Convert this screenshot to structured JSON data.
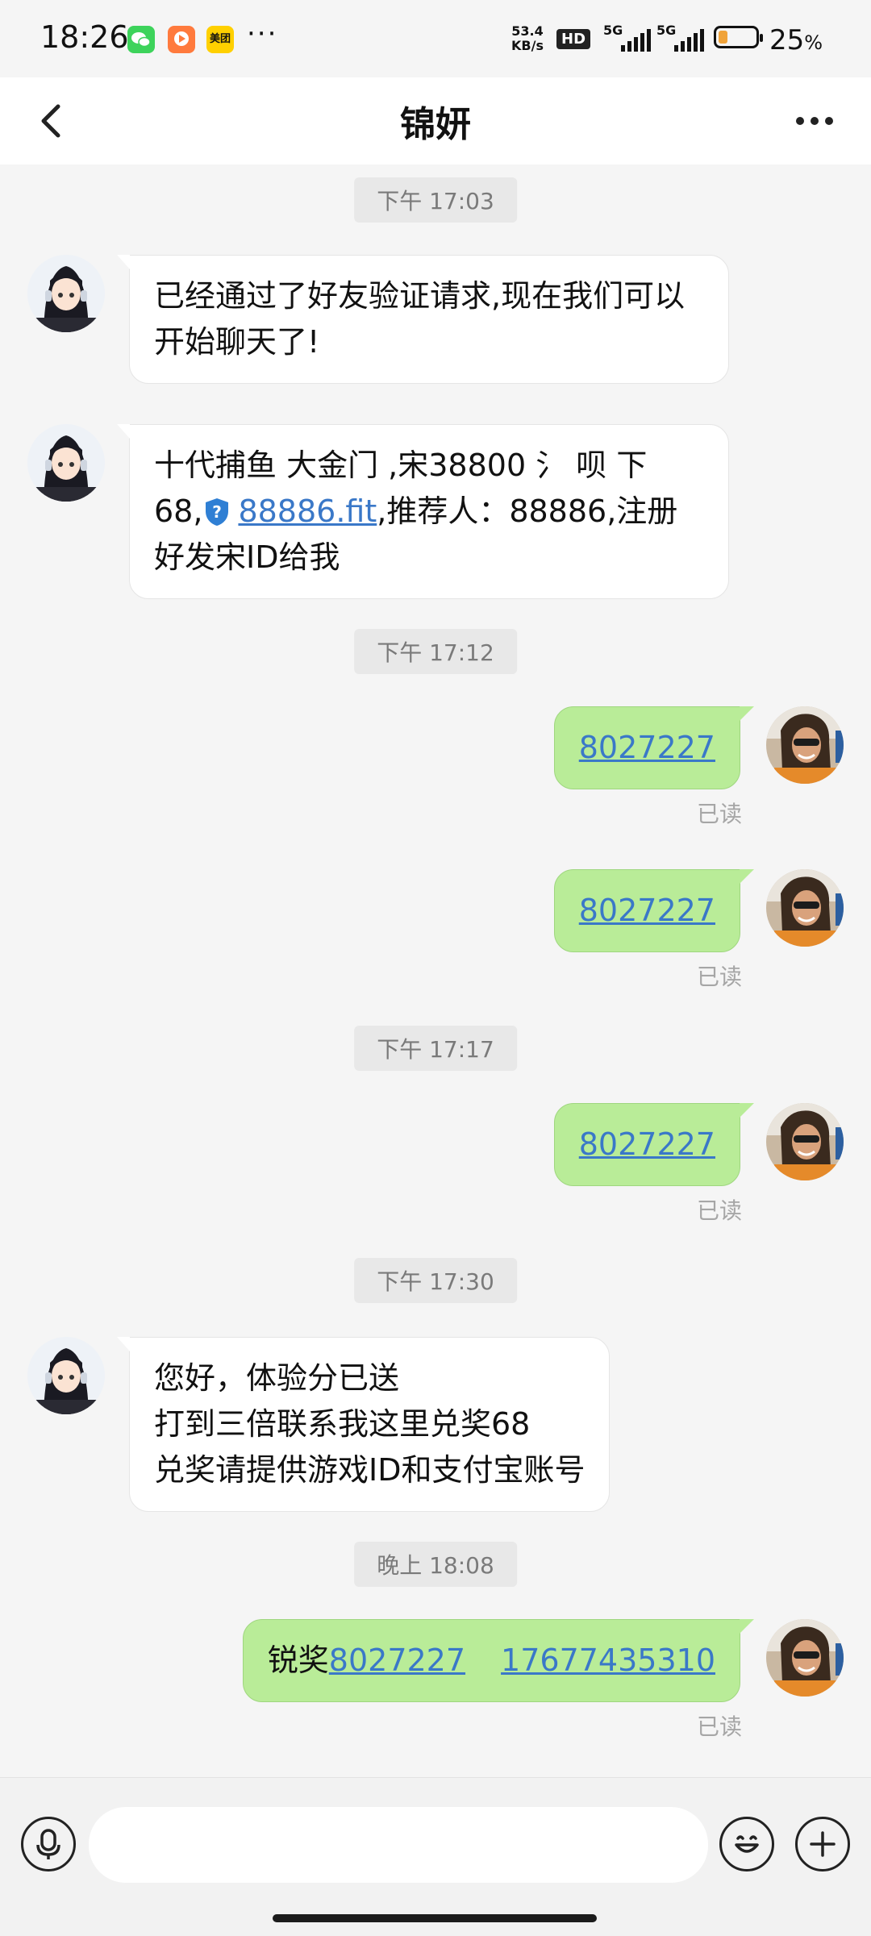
{
  "status_bar": {
    "time": "18:26",
    "net_speed_value": "53.4",
    "net_speed_unit": "KB/s",
    "hd_label": "HD",
    "signal1_label": "5G",
    "signal2_label": "5G",
    "battery_percent": "25",
    "battery_unit": "%",
    "battery_level": 0.25,
    "meituan_label": "美团",
    "more_dots": "···"
  },
  "header": {
    "title": "锦妍"
  },
  "messages": {
    "ts1": "下午 17:03",
    "m1_text": "已经通过了好友验证请求,现在我们可以开始聊天了!",
    "m2_line1": "十代捕鱼  大金门  ,宋38800 氵 呗 下",
    "m2_prefix": "68,",
    "m2_link": "88886.fit",
    "m2_suffix": ",推荐人：88886,注册",
    "m2_line3": "好发宋ID给我",
    "ts2": "下午 17:12",
    "o1_text": "8027227",
    "o1_read": "已读",
    "o2_text": "8027227",
    "o2_read": "已读",
    "ts3": "下午 17:17",
    "o3_text": "8027227",
    "o3_read": "已读",
    "ts4": "下午 17:30",
    "m3_line1": "您好，体验分已送",
    "m3_line2": "打到三倍联系我这里兑奖68",
    "m3_line3": "兑奖请提供游戏ID和支付宝账号",
    "ts5": "晚上 18:08",
    "o4_prefix": "锐奖",
    "o4_link1": "8027227",
    "o4_link2": "17677435310",
    "o4_read": "已读"
  },
  "input_bar": {
    "placeholder": ""
  },
  "colors": {
    "outgoing_bubble": "#b9ec98",
    "incoming_bubble": "#ffffff",
    "link": "#3a78c8",
    "background": "#f5f5f5"
  }
}
